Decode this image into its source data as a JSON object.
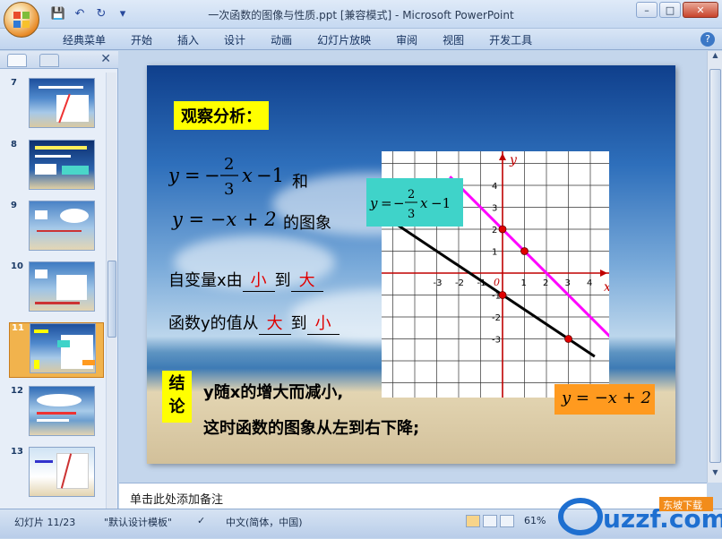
{
  "window": {
    "title": "一次函数的图像与性质.ppt [兼容模式] - Microsoft PowerPoint",
    "qat": [
      "save-icon",
      "undo-icon",
      "redo-icon",
      "customize-icon"
    ]
  },
  "ribbon": {
    "tabs": [
      "经典菜单",
      "开始",
      "插入",
      "设计",
      "动画",
      "幻灯片放映",
      "审阅",
      "视图",
      "开发工具"
    ]
  },
  "sidebar": {
    "thumbnails": [
      {
        "num": "7"
      },
      {
        "num": "8"
      },
      {
        "num": "9"
      },
      {
        "num": "10"
      },
      {
        "num": "11",
        "selected": true
      },
      {
        "num": "12"
      },
      {
        "num": "13"
      }
    ]
  },
  "slide": {
    "heading": "观察分析：",
    "line1_suffix": "和",
    "line2_suffix": "的图象",
    "q1_prefix": "自变量x由",
    "q1_ans1": "小",
    "q1_mid": "到",
    "q1_ans2": "大",
    "q2_prefix": "函数y的值从",
    "q2_ans1": "大",
    "q2_mid": "到",
    "q2_ans2": "小",
    "conclusion_label_1": "结",
    "conclusion_label_2": "论",
    "conclusion_line1": "y随x的增大而减小,",
    "conclusion_line2": "这时函数的图象从左到右下降;",
    "colors": {
      "heading_bg": "#ffff00",
      "answer": "#e00000",
      "magenta_line": "#ff00ff",
      "black_line": "#000000",
      "eq_box_cyan": "#3fd3c9",
      "eq_box_orange": "#ff9a1f",
      "axis": "#c00000"
    },
    "graph": {
      "x_label": "x",
      "y_label": "y",
      "origin_label": "0",
      "x_ticks": [
        "-3",
        "-2",
        "-1",
        "1",
        "2",
        "3",
        "4"
      ],
      "y_ticks": [
        "4",
        "3",
        "2",
        "1",
        "-1",
        "-2",
        "-3"
      ]
    },
    "eq_box1": {
      "y": "y",
      "eq": "=",
      "minus": "−",
      "num": "2",
      "den": "3",
      "x": "x",
      "tail": "−1"
    },
    "eq_box2": {
      "text": "y = −x + 2"
    },
    "eq_main1": {
      "y": "y",
      "eq": "=",
      "minus": "−",
      "num": "2",
      "den": "3",
      "x": "x",
      "tail": "−1"
    },
    "eq_main2": {
      "text": "y = −x + 2"
    }
  },
  "notes": {
    "placeholder": "单击此处添加备注"
  },
  "status": {
    "slide_info": "幻灯片 11/23",
    "theme": "\"默认设计模板\"",
    "language": "中文(简体，中国)",
    "zoom": "61%",
    "watermark": "uzzf.com",
    "watermark_sub": "东坡下载"
  }
}
